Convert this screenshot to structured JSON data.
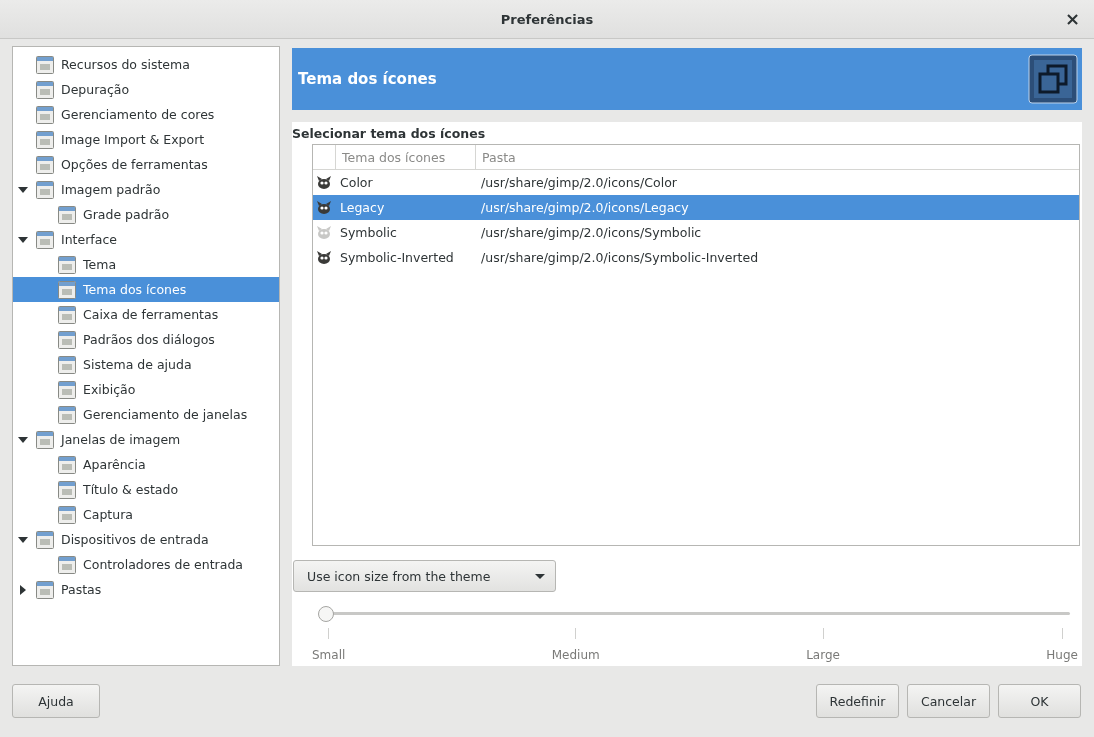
{
  "window": {
    "title": "Preferências",
    "close": "×"
  },
  "sidebar": {
    "items": [
      {
        "label": "Recursos do sistema",
        "selected": false
      },
      {
        "label": "Depuração",
        "selected": false
      },
      {
        "label": "Gerenciamento de cores",
        "selected": false
      },
      {
        "label": "Image Import & Export",
        "selected": false
      },
      {
        "label": "Opções de ferramentas",
        "selected": false
      },
      {
        "label": "Imagem padrão",
        "selected": false,
        "expanded": true,
        "children": [
          {
            "label": "Grade padrão",
            "selected": false
          }
        ]
      },
      {
        "label": "Interface",
        "selected": false,
        "expanded": true,
        "children": [
          {
            "label": "Tema",
            "selected": false
          },
          {
            "label": "Tema dos ícones",
            "selected": true
          },
          {
            "label": "Caixa de ferramentas",
            "selected": false
          },
          {
            "label": "Padrãos dos diálogos",
            "selected": false
          },
          {
            "label": "Sistema de ajuda",
            "selected": false
          },
          {
            "label": "Exibição",
            "selected": false
          },
          {
            "label": "Gerenciamento de janelas",
            "selected": false
          }
        ]
      },
      {
        "label": "Janelas de imagem",
        "selected": false,
        "expanded": true,
        "children": [
          {
            "label": "Aparência",
            "selected": false
          },
          {
            "label": "Título & estado",
            "selected": false
          },
          {
            "label": "Captura",
            "selected": false
          }
        ]
      },
      {
        "label": "Dispositivos de entrada",
        "selected": false,
        "expanded": true,
        "children": [
          {
            "label": "Controladores de entrada",
            "selected": false
          }
        ]
      },
      {
        "label": "Pastas",
        "selected": false,
        "expanded": false
      }
    ]
  },
  "page": {
    "title": "Tema dos ícones",
    "section": "Selecionar tema dos ícones",
    "table": {
      "columns": [
        "Tema dos ícones",
        "Pasta"
      ],
      "rows": [
        {
          "name": "Color",
          "folder": "/usr/share/gimp/2.0/icons/Color",
          "selected": false
        },
        {
          "name": "Legacy",
          "folder": "/usr/share/gimp/2.0/icons/Legacy",
          "selected": true
        },
        {
          "name": "Symbolic",
          "folder": "/usr/share/gimp/2.0/icons/Symbolic",
          "selected": false
        },
        {
          "name": "Symbolic-Inverted",
          "folder": "/usr/share/gimp/2.0/icons/Symbolic-Inverted",
          "selected": false
        }
      ]
    },
    "size_dropdown": "Use icon size from the theme",
    "size_slider": {
      "level": 0,
      "ticks": [
        "Small",
        "Medium",
        "Large",
        "Huge"
      ]
    }
  },
  "buttons": {
    "help": "Ajuda",
    "actions": [
      "Redefinir",
      "Cancelar",
      "OK"
    ]
  }
}
